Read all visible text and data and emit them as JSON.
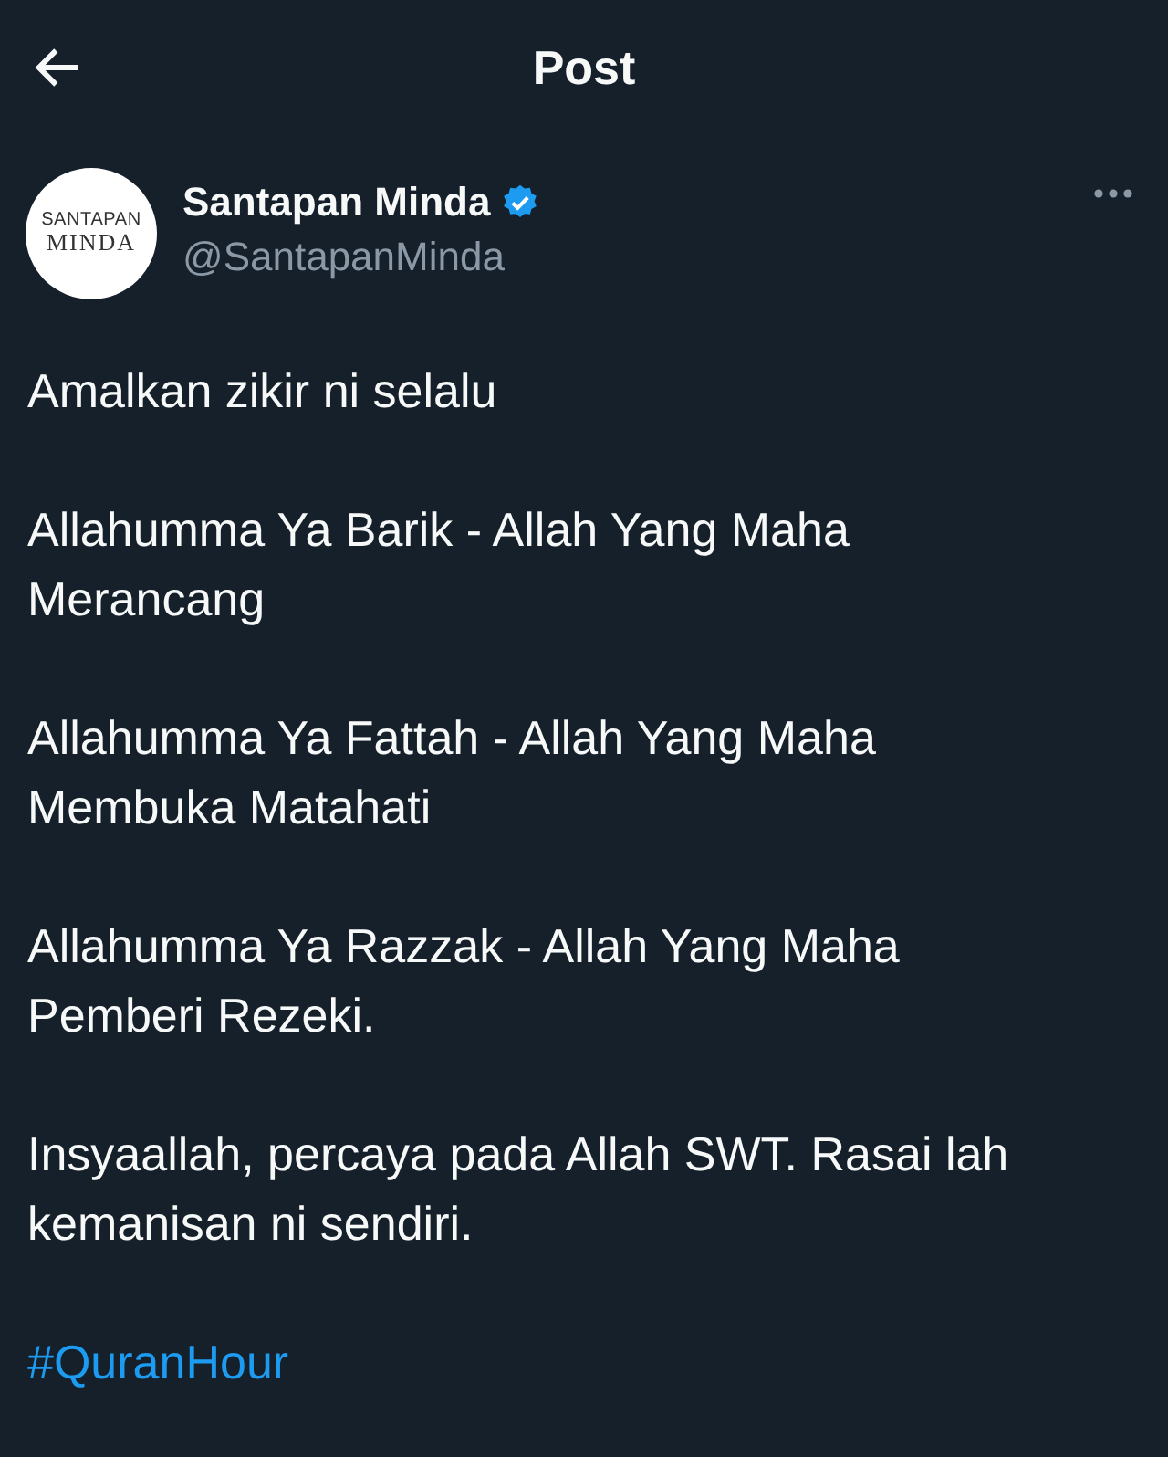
{
  "header": {
    "title": "Post"
  },
  "author": {
    "name": "Santapan Minda",
    "handle": "@SantapanMinda",
    "verified": true,
    "avatar_text": [
      "SANTAPAN",
      "MINDA"
    ]
  },
  "paragraphs": [
    "Amalkan zikir ni selalu",
    "Allahumma Ya Barik - Allah Yang Maha Merancang",
    "Allahumma Ya Fattah - Allah Yang Maha Membuka Matahati",
    "Allahumma Ya Razzak - Allah Yang Maha Pemberi Rezeki.",
    "Insyaallah, percaya pada Allah SWT. Rasai lah kemanisan ni sendiri."
  ],
  "hashtag": "#QuranHour"
}
